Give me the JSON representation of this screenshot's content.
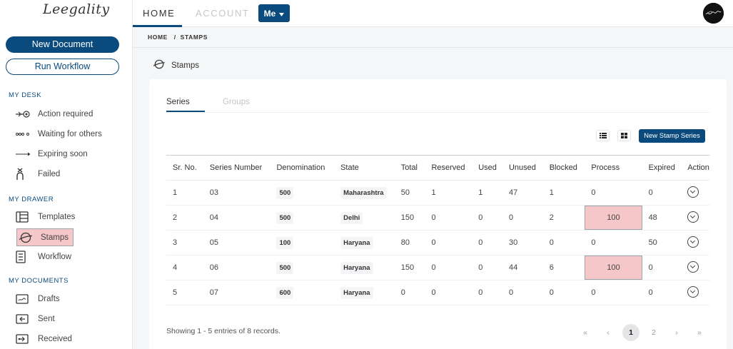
{
  "app": {
    "logo_text": "Leegality"
  },
  "sidebar": {
    "new_document": "New Document",
    "run_workflow": "Run Workflow",
    "sections": [
      {
        "title": "MY DESK",
        "items": [
          {
            "label": "Action required",
            "icon": "arrow-target-icon"
          },
          {
            "label": "Waiting for others",
            "icon": "dots-icon"
          },
          {
            "label": "Expiring soon",
            "icon": "arrow-right-icon"
          },
          {
            "label": "Failed",
            "icon": "failed-icon"
          }
        ]
      },
      {
        "title": "MY DRAWER",
        "items": [
          {
            "label": "Templates",
            "icon": "templates-icon"
          },
          {
            "label": "Stamps",
            "icon": "stamp-icon",
            "active": true
          },
          {
            "label": "Workflow",
            "icon": "workflow-icon"
          }
        ]
      },
      {
        "title": "MY DOCUMENTS",
        "items": [
          {
            "label": "Drafts",
            "icon": "drafts-icon"
          },
          {
            "label": "Sent",
            "icon": "sent-icon"
          },
          {
            "label": "Received",
            "icon": "received-icon"
          }
        ]
      }
    ]
  },
  "topbar": {
    "home": "HOME",
    "account": "ACCOUNT",
    "me": "Me"
  },
  "breadcrumb": "HOME   /  STAMPS",
  "page_title": "Stamps",
  "tabs": {
    "series": "Series",
    "groups": "Groups"
  },
  "new_series_button": "New Stamp Series",
  "table": {
    "columns": [
      "Sr. No.",
      "Series Number",
      "Denomination",
      "State",
      "Total",
      "Reserved",
      "Used",
      "Unused",
      "Blocked",
      "Process",
      "Expired",
      "Action"
    ],
    "rows": [
      {
        "sr": "1",
        "series": "03",
        "denomination": "500",
        "state": "Maharashtra",
        "total": "50",
        "reserved": "1",
        "used": "1",
        "unused": "47",
        "blocked": "1",
        "process": "0",
        "expired": "0",
        "highlight_process": false
      },
      {
        "sr": "2",
        "series": "04",
        "denomination": "500",
        "state": "Delhi",
        "total": "150",
        "reserved": "0",
        "used": "0",
        "unused": "0",
        "blocked": "2",
        "process": "100",
        "expired": "48",
        "highlight_process": true
      },
      {
        "sr": "3",
        "series": "05",
        "denomination": "100",
        "state": "Haryana",
        "total": "80",
        "reserved": "0",
        "used": "0",
        "unused": "30",
        "blocked": "0",
        "process": "0",
        "expired": "50",
        "highlight_process": false
      },
      {
        "sr": "4",
        "series": "06",
        "denomination": "500",
        "state": "Haryana",
        "total": "150",
        "reserved": "0",
        "used": "0",
        "unused": "44",
        "blocked": "6",
        "process": "100",
        "expired": "0",
        "highlight_process": true
      },
      {
        "sr": "5",
        "series": "07",
        "denomination": "600",
        "state": "Haryana",
        "total": "0",
        "reserved": "0",
        "used": "0",
        "unused": "0",
        "blocked": "0",
        "process": "0",
        "expired": "0",
        "highlight_process": false
      }
    ]
  },
  "footer": {
    "showing": "Showing 1 - 5 entries of 8 records."
  },
  "pagination": {
    "first": "«",
    "prev": "‹",
    "pages": [
      "1",
      "2"
    ],
    "current": "1",
    "next": "›",
    "last": "»"
  },
  "colors": {
    "brand": "#0a4a7c",
    "highlight": "#f6c7c9"
  }
}
